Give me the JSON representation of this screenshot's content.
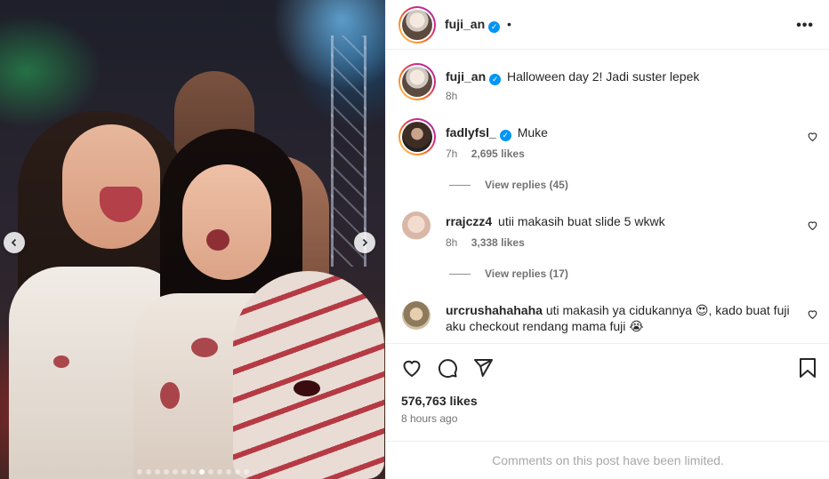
{
  "media": {
    "prev_icon": "chevron-left-icon",
    "next_icon": "chevron-right-icon",
    "slide_count": 13,
    "active_slide": 8
  },
  "header": {
    "username": "fuji_an",
    "verified": true,
    "separator": "•",
    "more_icon": "more-horizontal-icon"
  },
  "caption": {
    "username": "fuji_an",
    "text": "Halloween day 2! Jadi suster lepek",
    "time": "8h"
  },
  "comments": [
    {
      "username": "fadlyfsl_",
      "verified": true,
      "text": "Muke",
      "time": "7h",
      "likes": "2,695 likes",
      "replies": "View replies (45)"
    },
    {
      "username": "rrajczz4",
      "verified": false,
      "text": "utii makasih buat slide 5 wkwk",
      "time": "8h",
      "likes": "3,338 likes",
      "replies": "View replies (17)"
    },
    {
      "username": "urcrushahahaha",
      "verified": false,
      "text_line1": "uti makasih ya cidukannya 😍, kado buat fuji",
      "text_line2": "aku checkout rendang mama fuji 😭"
    }
  ],
  "actions": {
    "like_icon": "heart-icon",
    "comment_icon": "comment-icon",
    "share_icon": "send-icon",
    "save_icon": "bookmark-icon"
  },
  "likes_count": "576,763 likes",
  "posted_ago": "8 hours ago",
  "comments_limited": "Comments on this post have been limited.",
  "colors": {
    "verified_blue": "#0095f6",
    "muted_text": "#737373",
    "limited_text": "#a8a8a8"
  }
}
